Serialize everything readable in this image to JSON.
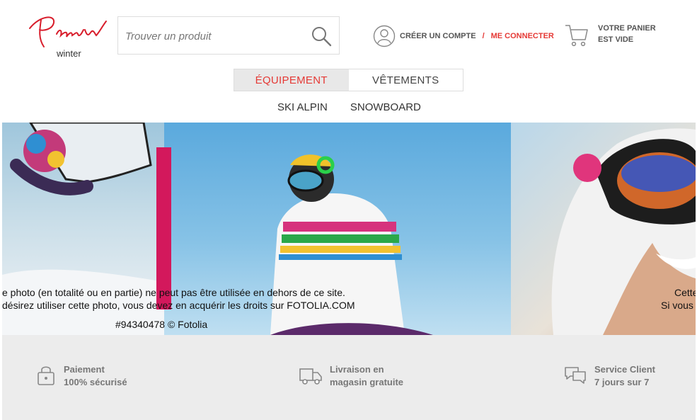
{
  "brand": {
    "logo_text": "Precilia",
    "sub": "winter",
    "accent": "#e53935"
  },
  "search": {
    "placeholder": "Trouver un produit"
  },
  "account": {
    "create": "CRÉER UN COMPTE",
    "separator": "/",
    "login": "ME CONNECTER"
  },
  "cart": {
    "line1": "VOTRE PANIER",
    "line2": "EST VIDE"
  },
  "nav": {
    "tabs": [
      {
        "label": "ÉQUIPEMENT",
        "active": true
      },
      {
        "label": "VÊTEMENTS",
        "active": false
      }
    ],
    "sub": [
      "SKI ALPIN",
      "SNOWBOARD"
    ]
  },
  "banner": {
    "watermark_line1": "e photo (en totalité ou en partie) ne peut pas être utilisée en dehors de ce site.",
    "watermark_line2": " désirez utiliser cette photo, vous devez en acquérir les droits sur FOTOLIA.COM",
    "watermark_id": "#94340478 © Fotolia",
    "right_line1": "Cette",
    "right_line2": "Si vous",
    "bar_color": "#d3185c"
  },
  "features": [
    {
      "icon": "lock-icon",
      "line1": "Paiement",
      "line2": "100% sécurisé"
    },
    {
      "icon": "truck-icon",
      "line1": "Livraison en",
      "line2": "magasin gratuite"
    },
    {
      "icon": "chat-icon",
      "line1": "Service Client",
      "line2": "7 jours sur 7"
    }
  ]
}
